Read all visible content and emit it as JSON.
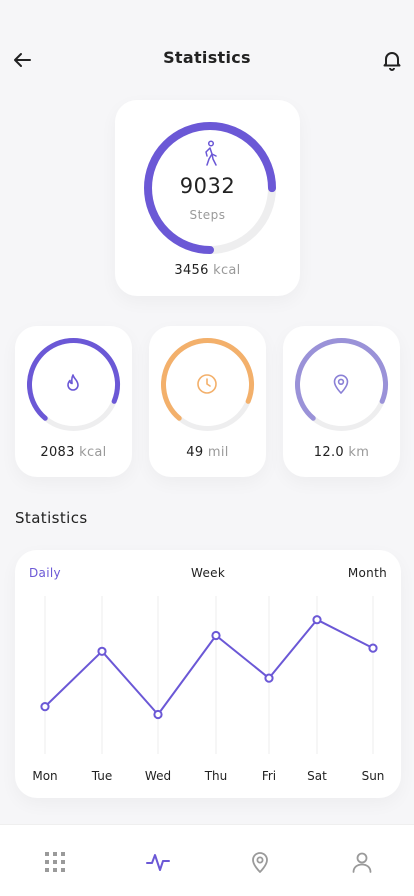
{
  "header": {
    "title": "Statistics",
    "back_icon": "arrow-left-icon",
    "bell_icon": "bell-icon"
  },
  "main_card": {
    "steps": "9032",
    "steps_label": "Steps",
    "kcal_value": "3456",
    "kcal_unit": "kcal",
    "progress": 0.75,
    "accent": "#6b58d6"
  },
  "stats": [
    {
      "value": "2083",
      "unit": "kcal",
      "icon": "flame-icon",
      "color": "#6b58d6",
      "progress": 0.7
    },
    {
      "value": "49",
      "unit": "mil",
      "icon": "clock-icon",
      "color": "#f3b06b",
      "progress": 0.7
    },
    {
      "value": "12.0",
      "unit": "km",
      "icon": "location-pin-icon",
      "color": "#9a92d8",
      "progress": 0.7
    }
  ],
  "section": {
    "title": "Statistics"
  },
  "tabs": {
    "daily": "Daily",
    "week": "Week",
    "month": "Month",
    "active": "Daily"
  },
  "chart_data": {
    "type": "line",
    "categories": [
      "Mon",
      "Tue",
      "Wed",
      "Thu",
      "Fri",
      "Sat",
      "Sun"
    ],
    "values": [
      30,
      65,
      25,
      75,
      48,
      85,
      67
    ],
    "ylim": [
      0,
      100
    ],
    "grid": true,
    "color": "#6b58d6"
  },
  "nav": [
    "grid-icon",
    "activity-icon",
    "location-pin-icon",
    "user-icon"
  ]
}
